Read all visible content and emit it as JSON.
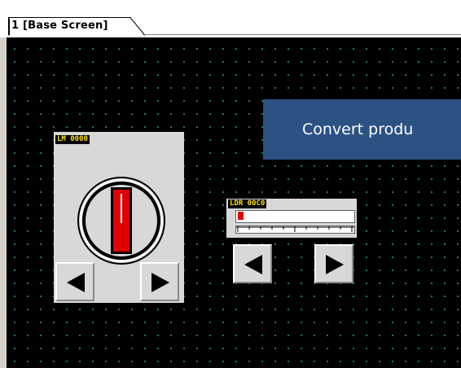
{
  "tab": {
    "label": "1 [Base Screen]"
  },
  "banner": {
    "text": "Convert produ"
  },
  "selector": {
    "tag": "LM 0000",
    "position": 0
  },
  "slider": {
    "tag": "LDR 00C0",
    "level": 0.05
  },
  "colors": {
    "canvas": "#000000",
    "grid_dot": "#2a8a6a",
    "banner": "#2b5283",
    "panel": "#d8d8d8",
    "indicator": "#e00000",
    "tag_text": "#ffe000"
  },
  "icons": {
    "left": "left-arrow-icon",
    "right": "right-arrow-icon",
    "knob": "selector-knob-icon"
  }
}
